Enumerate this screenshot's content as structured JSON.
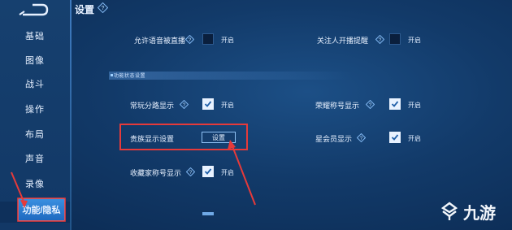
{
  "header": {
    "title": "设置"
  },
  "sidebar": {
    "items": [
      {
        "label": "基础"
      },
      {
        "label": "图像"
      },
      {
        "label": "战斗"
      },
      {
        "label": "操作"
      },
      {
        "label": "布局"
      },
      {
        "label": "声音"
      },
      {
        "label": "录像"
      },
      {
        "label": "功能/隐私",
        "active": true
      }
    ]
  },
  "settings": {
    "allow_voice_live": {
      "label": "允许语音被直播",
      "state": "开启",
      "checked": false
    },
    "follow_stream_reminder": {
      "label": "关注人开播提醒",
      "state": "开启",
      "checked": false
    },
    "section_title": "功能状态设置",
    "lane_display": {
      "label": "常玩分路显示",
      "state": "开启",
      "checked": true
    },
    "honor_title_display": {
      "label": "荣耀称号显示",
      "state": "开启",
      "checked": true
    },
    "noble_display": {
      "label": "贵族显示设置",
      "button": "设置"
    },
    "star_member_display": {
      "label": "星会员显示",
      "state": "开启",
      "checked": true
    },
    "collector_title_display": {
      "label": "收藏家称号显示",
      "state": "开启",
      "checked": true
    }
  },
  "watermark": {
    "text": "九游"
  },
  "colors": {
    "accent": "#3a8fe0",
    "highlight": "#e63a3a",
    "background": "#123a69"
  }
}
